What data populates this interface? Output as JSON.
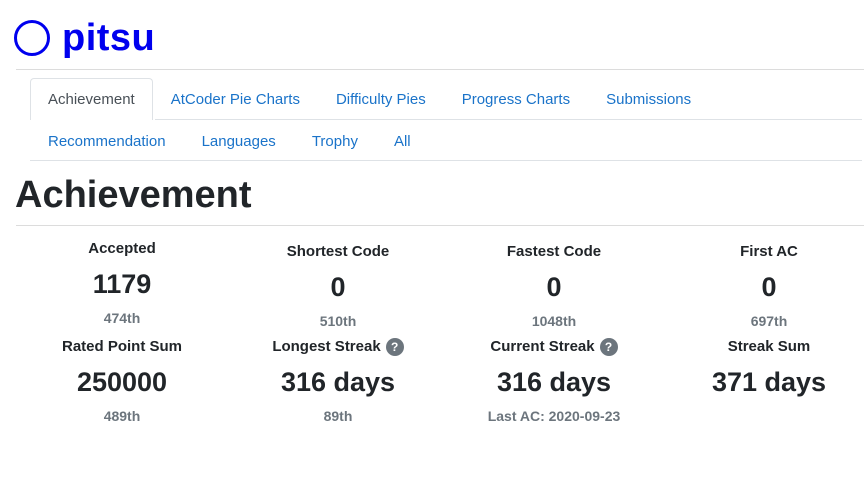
{
  "user": {
    "name": "pitsu"
  },
  "tabs": {
    "row1": [
      "Achievement",
      "AtCoder Pie Charts",
      "Difficulty Pies",
      "Progress Charts",
      "Submissions"
    ],
    "row2": [
      "Recommendation",
      "Languages",
      "Trophy",
      "All"
    ],
    "active": "Achievement"
  },
  "section": {
    "title": "Achievement"
  },
  "stats": [
    {
      "label": "Accepted",
      "value": "1179",
      "sub": "474th",
      "help": false
    },
    {
      "label": "Shortest Code",
      "value": "0",
      "sub": "510th",
      "help": false
    },
    {
      "label": "Fastest Code",
      "value": "0",
      "sub": "1048th",
      "help": false
    },
    {
      "label": "First AC",
      "value": "0",
      "sub": "697th",
      "help": false
    },
    {
      "label": "Rated Point Sum",
      "value": "250000",
      "sub": "489th",
      "help": false
    },
    {
      "label": "Longest Streak",
      "value": "316 days",
      "sub": "89th",
      "help": true
    },
    {
      "label": "Current Streak",
      "value": "316 days",
      "sub": "Last AC: 2020-09-23",
      "help": true
    },
    {
      "label": "Streak Sum",
      "value": "371 days",
      "sub": "",
      "help": false
    }
  ],
  "icons": {
    "help": "question-circle-icon",
    "help_glyph": "?",
    "user": "user-ring-icon"
  },
  "colors": {
    "user_blue": "#0000ee",
    "link": "#1a73c9",
    "muted": "#6c757d"
  }
}
